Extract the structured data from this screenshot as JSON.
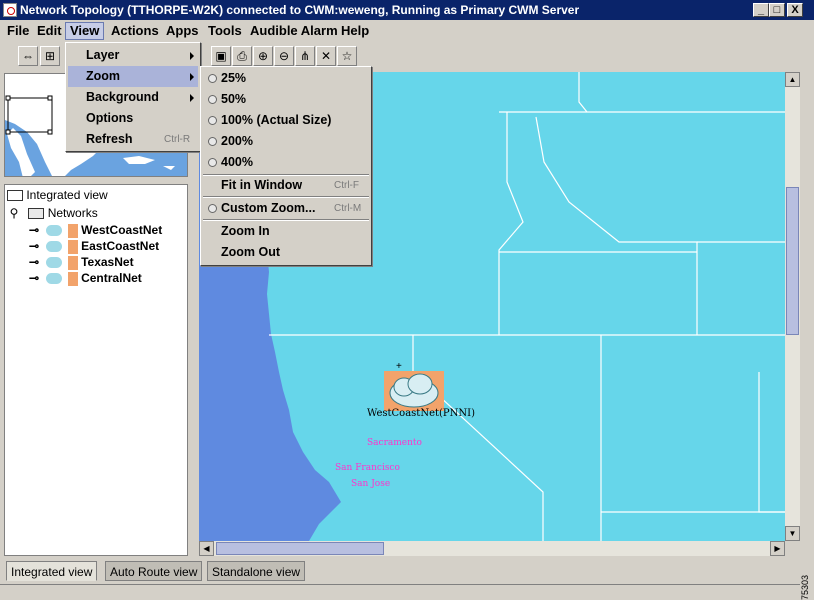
{
  "window": {
    "title": "Network Topology  (TTHORPE-W2K) connected to CWM:weweng, Running as Primary CWM Server",
    "controls": {
      "minimize": "_",
      "maximize": "□",
      "close": "X"
    }
  },
  "menubar": {
    "items": [
      {
        "label": "File"
      },
      {
        "label": "Edit"
      },
      {
        "label": "View"
      },
      {
        "label": "Actions"
      },
      {
        "label": "Apps"
      },
      {
        "label": "Tools"
      },
      {
        "label": "Audible Alarm"
      },
      {
        "label": "Help"
      }
    ],
    "active": "View"
  },
  "view_menu": {
    "items": [
      {
        "label": "Layer",
        "submenu": true
      },
      {
        "label": "Zoom",
        "submenu": true,
        "highlighted": true
      },
      {
        "label": "Background",
        "submenu": true
      },
      {
        "label": "Options"
      },
      {
        "label": "Refresh",
        "accelerator": "Ctrl-R"
      }
    ]
  },
  "zoom_menu": {
    "items": [
      {
        "label": "25%",
        "radio": true
      },
      {
        "label": "50%",
        "radio": true
      },
      {
        "label": "100% (Actual Size)",
        "radio": true
      },
      {
        "label": "200%",
        "radio": true
      },
      {
        "label": "400%",
        "radio": true
      },
      {
        "label": "Fit in Window",
        "accelerator": "Ctrl-F"
      },
      {
        "label": "Custom Zoom...",
        "accelerator": "Ctrl-M",
        "radio": true
      },
      {
        "label": "Zoom In"
      },
      {
        "label": "Zoom Out"
      }
    ]
  },
  "tree": {
    "root": "Integrated view",
    "group": "Networks",
    "networks": [
      {
        "label": "WestCoastNet"
      },
      {
        "label": "EastCoastNet"
      },
      {
        "label": "TexasNet"
      },
      {
        "label": "CentralNet"
      }
    ]
  },
  "map": {
    "network_node": "WestCoastNet(PNNI)",
    "cities": [
      "Sacramento",
      "San Francisco",
      "San Jose"
    ],
    "colors": {
      "land": "#66d6ea",
      "ocean": "#5f8ae0",
      "node_box": "#f2a36b",
      "city": "#ff33cc"
    }
  },
  "tabs": [
    {
      "label": "Integrated view",
      "selected": true
    },
    {
      "label": "Auto Route view"
    },
    {
      "label": "Standalone view"
    }
  ],
  "side_id": "75303"
}
